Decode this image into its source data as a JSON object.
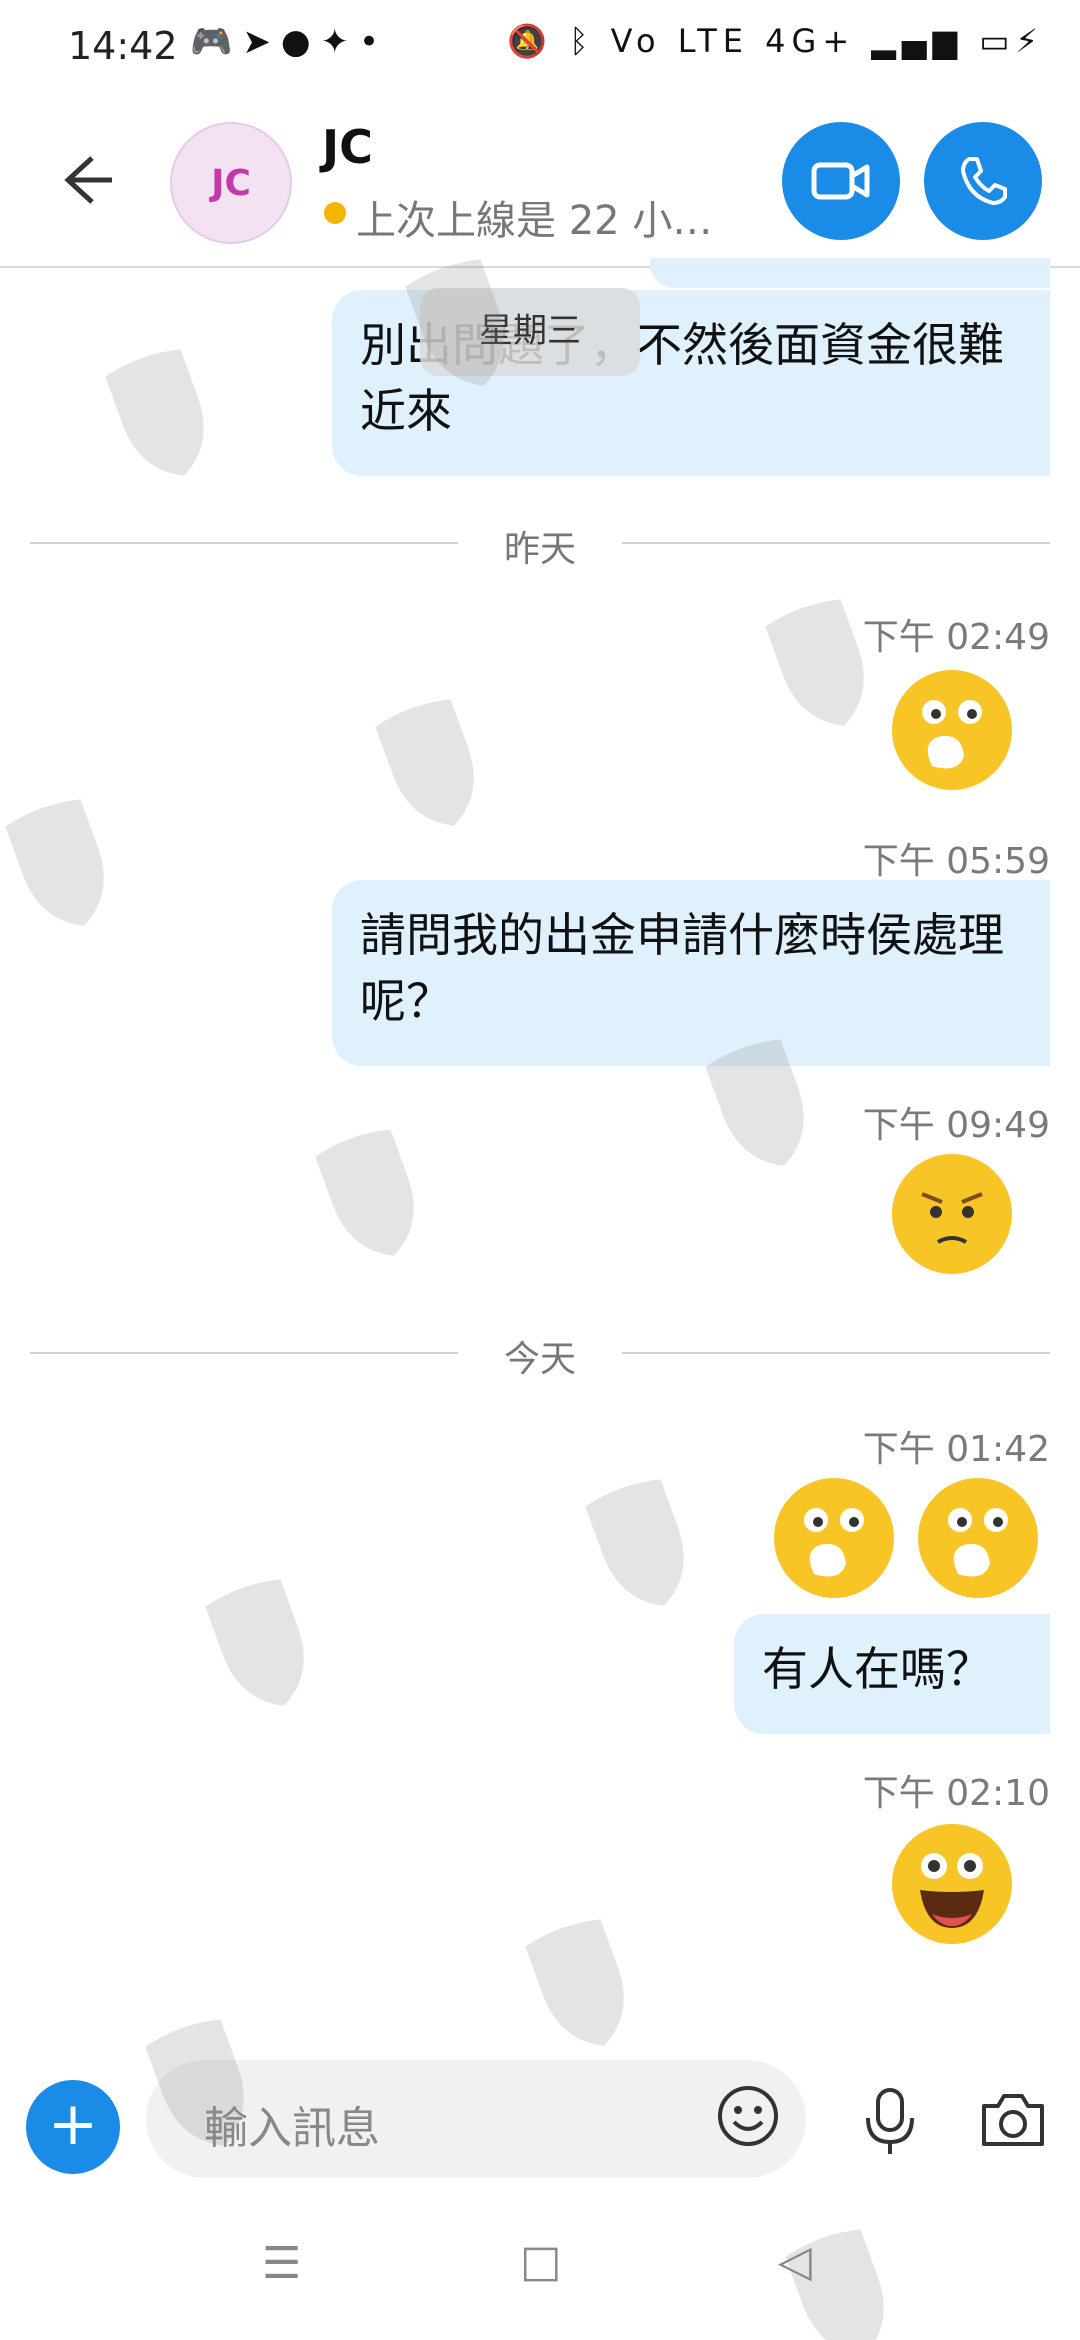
{
  "status_bar": {
    "time": "14:42",
    "left_icons": [
      "discord-icon",
      "telegram-icon",
      "line-icon",
      "messenger-icon",
      "dot-icon"
    ],
    "right_icons": [
      "mute-vibrate-icon",
      "bluetooth-icon",
      "volte-icon",
      "4g-signal-icon",
      "signal-icon",
      "battery-icon",
      "charging-icon"
    ],
    "right_text": "Vo LTE 4G+"
  },
  "header": {
    "avatar_initials": "JC",
    "contact_name": "JC",
    "presence_text": "上次上線是 22 小…",
    "accent_color": "#1a8be6"
  },
  "messages": {
    "floating_date": "星期三",
    "first_bubble": "別出問題了，不然後面資金很難近來",
    "divider_yesterday": "昨天",
    "ts1": "下午 02:49",
    "ts2": "下午 05:59",
    "bubble2": "請問我的出金申請什麼時侯處理呢？",
    "ts3": "下午 09:49",
    "divider_today": "今天",
    "ts4": "下午 01:42",
    "bubble3": "有人在嗎？",
    "ts5": "下午 02:10"
  },
  "composer": {
    "placeholder": "輸入訊息"
  },
  "system_nav": {
    "menu": "☰",
    "home": "□",
    "back": "◁"
  }
}
